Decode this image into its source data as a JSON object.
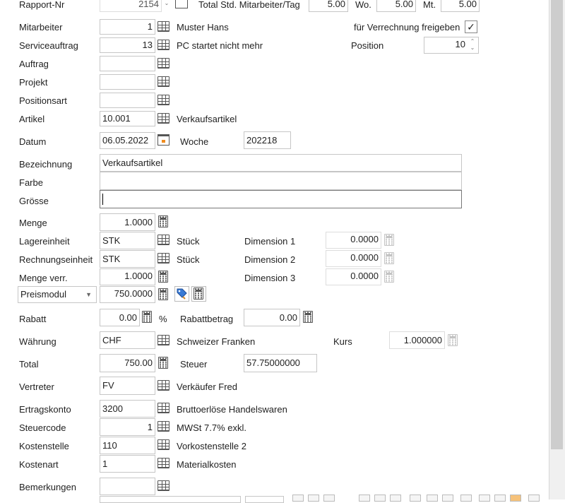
{
  "header": {
    "rapport_label": "Rapport-Nr",
    "rapport_value": "2154",
    "total_label": "Total Std. Mitarbeiter/Tag",
    "total_value": "5.00",
    "wo_label": "Wo.",
    "wo_value": "5.00",
    "mt_label": "Mt.",
    "mt_value": "5.00"
  },
  "mitarbeiter": {
    "label": "Mitarbeiter",
    "value": "1",
    "name": "Muster Hans"
  },
  "verrechnung": {
    "label": "für Verrechnung freigeben",
    "checked": "✓"
  },
  "serviceauftrag": {
    "label": "Serviceauftrag",
    "value": "13",
    "desc": "PC startet nicht mehr"
  },
  "position": {
    "label": "Position",
    "value": "10"
  },
  "auftrag": {
    "label": "Auftrag",
    "value": ""
  },
  "projekt": {
    "label": "Projekt",
    "value": ""
  },
  "positionsart": {
    "label": "Positionsart",
    "value": ""
  },
  "artikel": {
    "label": "Artikel",
    "value": "10.001",
    "desc": "Verkaufsartikel"
  },
  "datum": {
    "label": "Datum",
    "value": "06.05.2022",
    "woche_label": "Woche",
    "woche_value": "202218"
  },
  "bezeichnung": {
    "label": "Bezeichnung",
    "value": "Verkaufsartikel"
  },
  "farbe": {
    "label": "Farbe",
    "value": ""
  },
  "groesse": {
    "label": "Grösse",
    "value": ""
  },
  "menge": {
    "label": "Menge",
    "value": "1.0000"
  },
  "lagereinheit": {
    "label": "Lagereinheit",
    "value": "STK",
    "desc": "Stück",
    "dim_label": "Dimension 1",
    "dim_value": "0.0000"
  },
  "rechnungseinheit": {
    "label": "Rechnungseinheit",
    "value": "STK",
    "desc": "Stück",
    "dim_label": "Dimension 2",
    "dim_value": "0.0000"
  },
  "menge_verr": {
    "label": "Menge verr.",
    "value": "1.0000",
    "dim_label": "Dimension 3",
    "dim_value": "0.0000"
  },
  "preismodul": {
    "select_value": "Preismodul",
    "value": "750.0000"
  },
  "rabatt": {
    "label": "Rabatt",
    "value": "0.00",
    "unit": "%",
    "betrag_label": "Rabattbetrag",
    "betrag_value": "0.00"
  },
  "waehrung": {
    "label": "Währung",
    "value": "CHF",
    "desc": "Schweizer Franken",
    "kurs_label": "Kurs",
    "kurs_value": "1.000000"
  },
  "total": {
    "label": "Total",
    "value": "750.00",
    "steuer_label": "Steuer",
    "steuer_value": "57.75000000"
  },
  "vertreter": {
    "label": "Vertreter",
    "value": "FV",
    "desc": "Verkäufer Fred"
  },
  "ertragskonto": {
    "label": "Ertragskonto",
    "value": "3200",
    "desc": "Bruttoerlöse Handelswaren"
  },
  "steuercode": {
    "label": "Steuercode",
    "value": "1",
    "desc": "MWSt 7.7% exkl."
  },
  "kostenstelle": {
    "label": "Kostenstelle",
    "value": "110",
    "desc": "Vorkostenstelle 2"
  },
  "kostenart": {
    "label": "Kostenart",
    "value": "1",
    "desc": "Materialkosten"
  },
  "bemerkungen": {
    "label": "Bemerkungen",
    "value": ""
  }
}
